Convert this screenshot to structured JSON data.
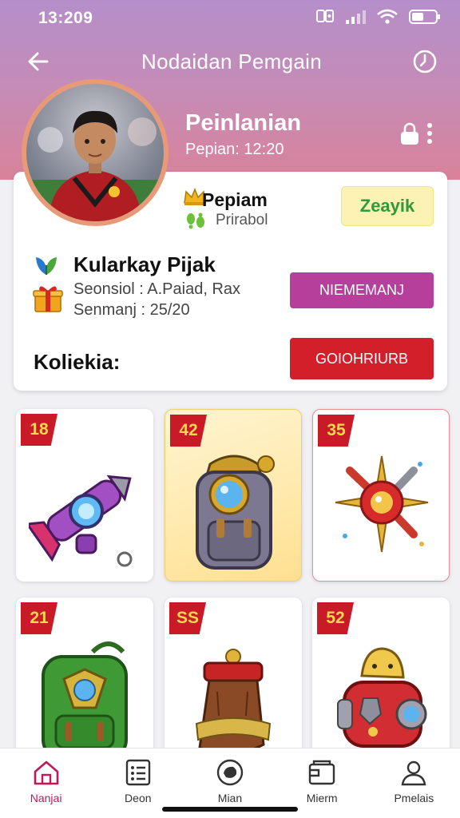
{
  "status_bar": {
    "time": "13:209",
    "icons": [
      "nfc-icon",
      "signal-icon",
      "wifi-icon",
      "battery-icon"
    ]
  },
  "header": {
    "title": "Nodaidan Pemgain",
    "back_icon": "arrow-left-icon",
    "right_icon": "clock-icon"
  },
  "profile": {
    "name": "Peinlanian",
    "subtitle": "Pepian: 12:20",
    "lock_icon": "lock-icon",
    "more_icon": "more-vertical-icon"
  },
  "card": {
    "label_primary": "Pepiam",
    "label_secondary": "Prirabol",
    "status_pill": "Zeayik",
    "section_title": "Kularkay Pijak",
    "line1": "Seonsiol : A.Paiad, Rax",
    "line2": "Senmanj : 25/20",
    "purple_button": "NIEMEMANJ",
    "collection_label": "Koliekia:",
    "red_button": "GOIOHRIURB"
  },
  "items": [
    {
      "badge": "18",
      "art": "rocket-gadget-icon"
    },
    {
      "badge": "42",
      "art": "backpack-icon"
    },
    {
      "badge": "35",
      "art": "compass-star-icon"
    },
    {
      "badge": "21",
      "art": "green-backpack-icon"
    },
    {
      "badge": "SS",
      "art": "leather-pouch-icon"
    },
    {
      "badge": "52",
      "art": "robot-helmet-icon"
    }
  ],
  "nav": [
    {
      "label": "Nanjai",
      "icon": "home-icon",
      "active": true
    },
    {
      "label": "Deon",
      "icon": "list-icon",
      "active": false
    },
    {
      "label": "Mian",
      "icon": "chat-icon",
      "active": false
    },
    {
      "label": "Mierm",
      "icon": "wallet-icon",
      "active": false
    },
    {
      "label": "Pmelais",
      "icon": "person-icon",
      "active": false
    }
  ],
  "colors": {
    "header_top": "#b58ec9",
    "header_bottom": "#d9829a",
    "accent_red": "#d31f2a",
    "accent_purple": "#b53f9a",
    "active_nav": "#c2185b",
    "badge": "#c81a27"
  }
}
